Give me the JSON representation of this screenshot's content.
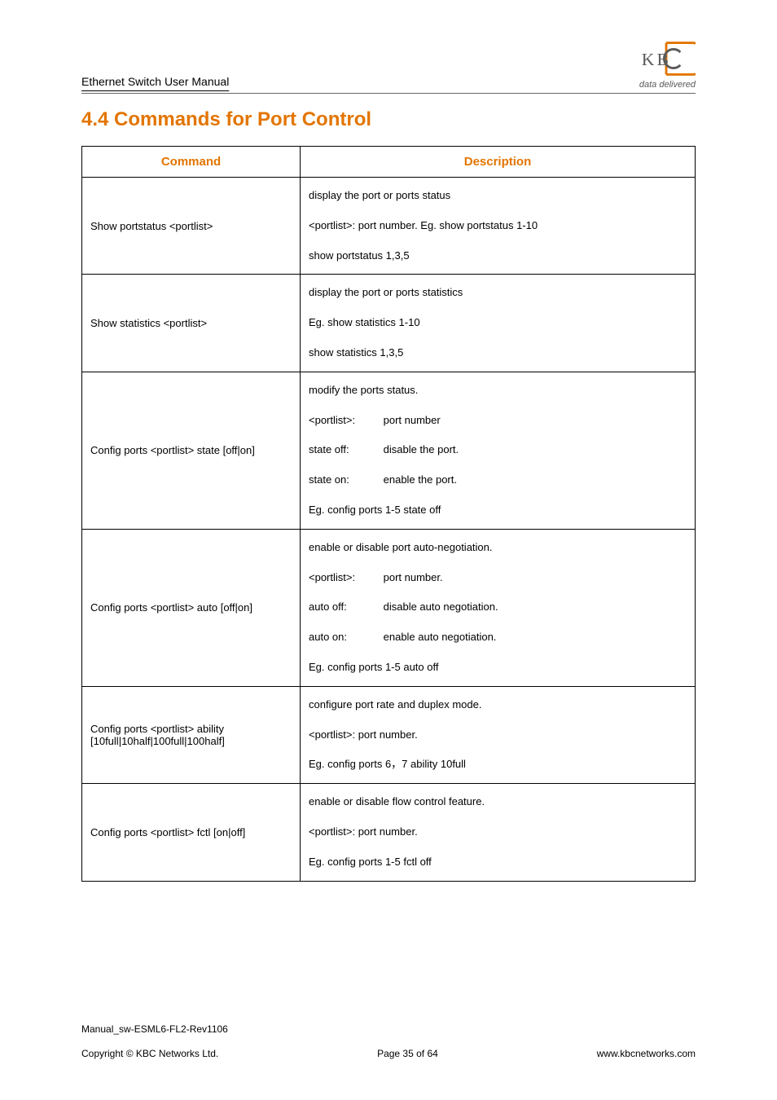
{
  "header": {
    "left": "Ethernet Switch User Manual",
    "logo_sub": "data delivered"
  },
  "section_title": "4.4 Commands for Port Control",
  "table": {
    "head": {
      "command": "Command",
      "description": "Description"
    },
    "rows": [
      {
        "command": "Show portstatus <portlist>",
        "desc": [
          "display the port or ports status",
          "<portlist>: port number. Eg. show portstatus 1-10",
          "show portstatus 1,3,5"
        ]
      },
      {
        "command": "Show statistics <portlist>",
        "desc": [
          "display the port or ports statistics",
          "Eg. show statistics 1-10",
          "show statistics 1,3,5"
        ]
      },
      {
        "command": "Config ports <portlist> state [off|on]",
        "desc_kv": {
          "lead": "modify the ports status.",
          "pairs": [
            {
              "k": "<portlist>:",
              "v": "port number"
            },
            {
              "k": "state off:",
              "v": "disable the port."
            },
            {
              "k": "state on:",
              "v": "enable the port."
            }
          ],
          "tail": "Eg. config ports 1-5 state off"
        }
      },
      {
        "command": "Config ports <portlist> auto [off|on]",
        "desc_kv": {
          "lead": "enable or disable port auto-negotiation.",
          "pairs": [
            {
              "k": "<portlist>:",
              "v": "port number."
            },
            {
              "k": "auto off:",
              "v": "disable auto negotiation."
            },
            {
              "k": "auto on:",
              "v": "enable auto negotiation."
            }
          ],
          "tail": "Eg. config ports 1-5 auto off"
        }
      },
      {
        "command": "Config ports <portlist> ability [10full|10half|100full|100half]",
        "desc": [
          "configure port rate and duplex mode.",
          "<portlist>: port number.",
          "Eg. config ports 6，7 ability 10full"
        ]
      },
      {
        "command": "Config ports <portlist> fctl [on|off]",
        "desc": [
          "enable or disable flow control feature.",
          "<portlist>: port number.",
          "Eg. config ports 1-5 fctl off"
        ]
      }
    ]
  },
  "footer": {
    "line1": "Manual_sw-ESML6-FL2-Rev1106",
    "copyright": "Copyright © KBC Networks Ltd.",
    "page": "Page 35 of 64",
    "url": "www.kbcnetworks.com"
  }
}
